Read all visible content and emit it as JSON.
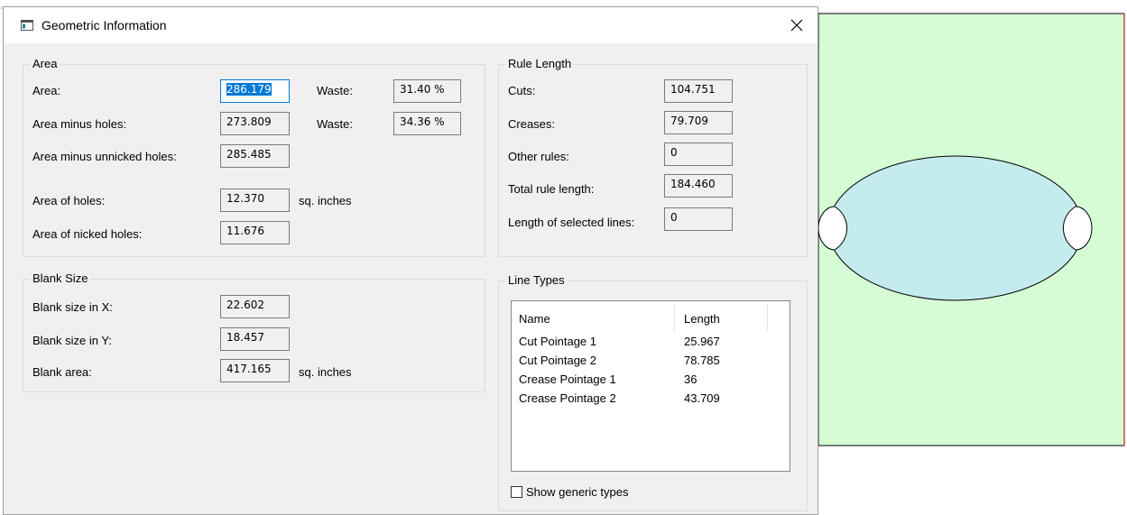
{
  "window": {
    "title": "Geometric Information",
    "close_symbol": "✕"
  },
  "area": {
    "legend": "Area",
    "area_label": "Area:",
    "area_value": "286.179",
    "waste_label_1": "Waste:",
    "waste_value_1": "31.40 %",
    "area_minus_holes_label": "Area minus holes:",
    "area_minus_holes_value": "273.809",
    "waste_label_2": "Waste:",
    "waste_value_2": "34.36 %",
    "area_minus_unnicked_label": "Area minus unnicked holes:",
    "area_minus_unnicked_value": "285.485",
    "area_of_holes_label": "Area of holes:",
    "area_of_holes_value": "12.370",
    "unit_label": "sq. inches",
    "area_of_nicked_label": "Area of nicked holes:",
    "area_of_nicked_value": "11.676"
  },
  "rule_length": {
    "legend": "Rule Length",
    "cuts_label": "Cuts:",
    "cuts_value": "104.751",
    "creases_label": "Creases:",
    "creases_value": "79.709",
    "other_label": "Other rules:",
    "other_value": "0",
    "total_label": "Total rule length:",
    "total_value": "184.460",
    "selected_label": "Length of selected lines:",
    "selected_value": "0"
  },
  "blank_size": {
    "legend": "Blank Size",
    "x_label": "Blank size in X:",
    "x_value": "22.602",
    "y_label": "Blank size in Y:",
    "y_value": "18.457",
    "area_label": "Blank area:",
    "area_value": "417.165",
    "unit_label": "sq. inches"
  },
  "line_types": {
    "legend": "Line Types",
    "columns": [
      "Name",
      "Length"
    ],
    "rows": [
      {
        "name": "Cut Pointage 1",
        "length": "25.967"
      },
      {
        "name": "Cut Pointage 2",
        "length": "78.785"
      },
      {
        "name": "Crease Pointage 1",
        "length": "36"
      },
      {
        "name": "Crease Pointage 2",
        "length": "43.709"
      }
    ],
    "show_generic_label": "Show generic types",
    "show_generic_checked": false
  },
  "colors": {
    "canvas_fill": "#d6fcd6",
    "ellipse_fill": "#c4ecee",
    "selection_accent": "#0078d7"
  },
  "icons": [
    "app-window-icon",
    "close-icon"
  ]
}
